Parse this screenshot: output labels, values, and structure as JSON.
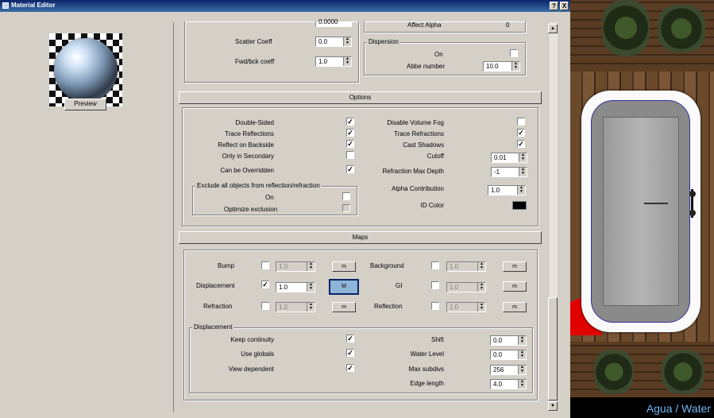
{
  "window": {
    "title": "Material Editor",
    "help_label": "?",
    "close_label": "X"
  },
  "preview": {
    "button_label": "Preview"
  },
  "top_section": {
    "truncated_value": "0.0000",
    "affect_alpha_label": "Affect Alpha",
    "affect_alpha_value": "0",
    "scatter_coeff_label": "Scatter Coeff",
    "scatter_coeff_value": "0.0",
    "fwd_bck_label": "Fwd/bck coeff",
    "fwd_bck_value": "1.0",
    "dispersion_group": "Dispersion",
    "dispersion_on_label": "On",
    "dispersion_on_checked": false,
    "abbe_label": "Abbe number",
    "abbe_value": "10.0"
  },
  "options": {
    "header": "Options",
    "left": [
      {
        "label": "Double-Sided",
        "checked": true
      },
      {
        "label": "Trace Reflections",
        "checked": true
      },
      {
        "label": "Reflect on Backside",
        "checked": true
      },
      {
        "label": "Only in Secondary",
        "checked": false
      },
      {
        "label": "Can be Overridden",
        "checked": true
      }
    ],
    "right_checks": [
      {
        "label": "Disable Volume Fog",
        "checked": false
      },
      {
        "label": "Trace Refractions",
        "checked": true
      },
      {
        "label": "Cast Shadows",
        "checked": true
      }
    ],
    "cutoff_label": "Cutoff",
    "cutoff_value": "0.01",
    "refraction_max_depth_label": "Refraction Max Depth",
    "refraction_max_depth_value": "-1",
    "alpha_contribution_label": "Alpha Contribution",
    "alpha_contribution_value": "1.0",
    "id_color_label": "ID Color",
    "id_color": "#000000",
    "exclude_group": "Exclude all objects from reflection/refraction",
    "exclude_on_label": "On",
    "exclude_on_checked": false,
    "optimize_exclusion_label": "Optimize exclusion",
    "optimize_exclusion_checked": false
  },
  "maps": {
    "header": "Maps",
    "rows_left": [
      {
        "label": "Bump",
        "checked": false,
        "value": "1.0",
        "map_label": "m",
        "enabled": false
      },
      {
        "label": "Displacement",
        "checked": true,
        "value": "1.0",
        "map_label": "M",
        "enabled": true
      },
      {
        "label": "Refraction",
        "checked": false,
        "value": "1.0",
        "map_label": "m",
        "enabled": false
      }
    ],
    "rows_right": [
      {
        "label": "Background",
        "checked": false,
        "value": "1.0",
        "map_label": "m"
      },
      {
        "label": "GI",
        "checked": false,
        "value": "1.0",
        "map_label": "m"
      },
      {
        "label": "Reflection",
        "checked": false,
        "value": "1.0",
        "map_label": "m"
      }
    ]
  },
  "displacement": {
    "group": "Displacement",
    "checks": [
      {
        "label": "Keep continuity",
        "checked": true
      },
      {
        "label": "Use globals",
        "checked": true
      },
      {
        "label": "View dependent",
        "checked": true
      }
    ],
    "fields": [
      {
        "label": "Shift",
        "value": "0.0"
      },
      {
        "label": "Water Level",
        "value": "0.0"
      },
      {
        "label": "Max subdivs",
        "value": "256"
      },
      {
        "label": "Edge length",
        "value": "4.0"
      }
    ]
  },
  "viewport": {
    "caption": "Agua / Water"
  },
  "colors": {
    "title_bar": "#0b246a",
    "accent_red": "#e00000",
    "caption": "#6fb6f2"
  }
}
